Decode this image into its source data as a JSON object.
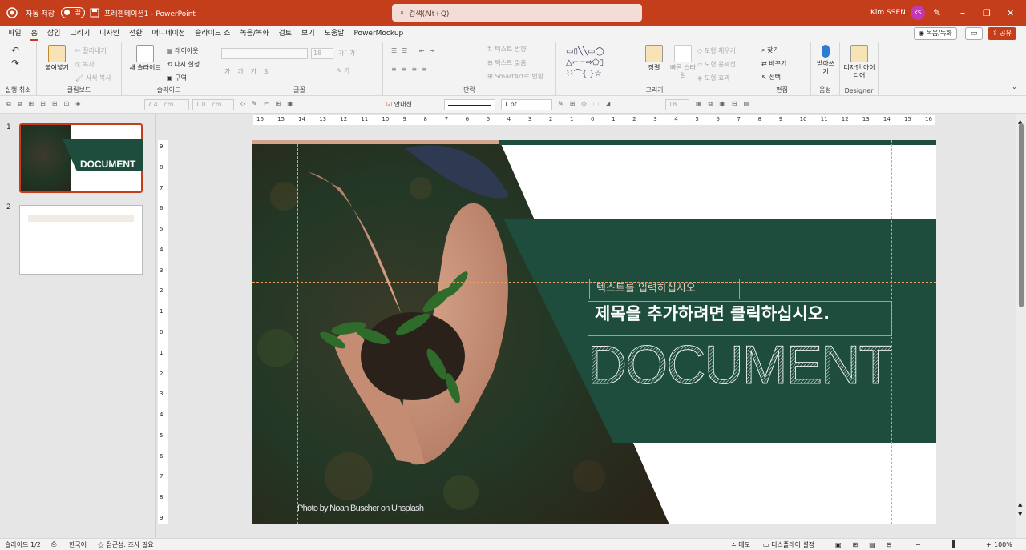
{
  "titlebar": {
    "autosave": "자동 저장",
    "autosave_state": "끔",
    "doc_title": "프레젠테이션1 - PowerPoint",
    "search_placeholder": "검색(Alt+Q)",
    "user": "Kim SSEN",
    "initials": "KS",
    "accent": "#c43e1c"
  },
  "menu": {
    "tabs": [
      "파일",
      "홈",
      "삽입",
      "그리기",
      "디자인",
      "전환",
      "애니메이션",
      "슬라이드 쇼",
      "녹음/녹화",
      "검토",
      "보기",
      "도움말",
      "PowerMockup"
    ],
    "record": "녹음/녹화",
    "share": "공유"
  },
  "ribbon": {
    "undo": "실행 취소",
    "clipboard": {
      "paste": "붙여넣기",
      "cut": "잘라내기",
      "copy": "복사",
      "format_painter": "서식 복사",
      "label": "클립보드"
    },
    "slides": {
      "new_slide": "새 슬라이드",
      "layout": "레이아웃",
      "reset": "다시 설정",
      "section": "구역",
      "label": "슬라이드"
    },
    "font": {
      "label": "글꼴",
      "size": "18"
    },
    "paragraph": {
      "text_direction": "텍스트 방향",
      "align_text": "텍스트 맞춤",
      "smartart": "SmartArt로 변환",
      "label": "단락"
    },
    "drawing": {
      "arrange": "정렬",
      "quick_styles": "빠른 스타일",
      "fill": "도형 채우기",
      "outline": "도형 윤곽선",
      "effects": "도형 효과",
      "label": "그리기"
    },
    "editing": {
      "find": "찾기",
      "replace": "바꾸기",
      "select": "선택",
      "label": "편집"
    },
    "voice": {
      "dictate": "받아쓰기",
      "label": "음성"
    },
    "designer": {
      "ideas": "디자인 아이디어",
      "label": "Designer"
    }
  },
  "format_bar": {
    "width": "7.41 cm",
    "height": "1.01 cm",
    "guides": "안내선",
    "line_weight": "1 pt",
    "fontsize": "18"
  },
  "ruler_h": [
    "16",
    "15",
    "14",
    "13",
    "12",
    "11",
    "10",
    "9",
    "8",
    "7",
    "6",
    "5",
    "4",
    "3",
    "2",
    "1",
    "0",
    "1",
    "2",
    "3",
    "4",
    "5",
    "6",
    "7",
    "8",
    "9",
    "10",
    "11",
    "12",
    "13",
    "14",
    "15",
    "16"
  ],
  "ruler_v": [
    "9",
    "8",
    "7",
    "6",
    "5",
    "4",
    "3",
    "2",
    "1",
    "0",
    "1",
    "2",
    "3",
    "4",
    "5",
    "6",
    "7",
    "8",
    "9"
  ],
  "thumbs": [
    {
      "num": "1",
      "title": "DOCUMENT"
    },
    {
      "num": "2"
    }
  ],
  "slide": {
    "subtitle_placeholder": "텍스트를 입력하십시오",
    "title_placeholder": "제목을 추가하려면 클릭하십시오.",
    "headline": "DOCUMENT",
    "credit": "Photo by Noah Buscher on Unsplash",
    "green": "#1e4d3e"
  },
  "status": {
    "slide": "슬라이드 1/2",
    "language": "한국어",
    "accessibility": "접근성: 조사 필요",
    "notes": "메모",
    "display": "디스플레이 설정",
    "zoom": "100%"
  }
}
